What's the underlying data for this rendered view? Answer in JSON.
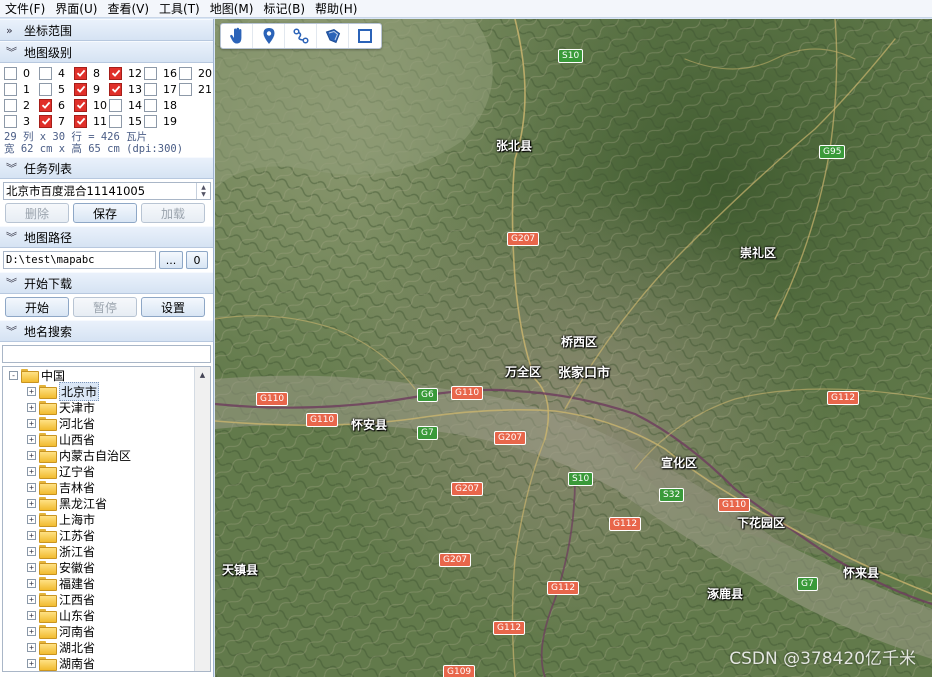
{
  "menubar": {
    "items": [
      "文件(F)",
      "界面(U)",
      "查看(V)",
      "工具(T)",
      "地图(M)",
      "标记(B)",
      "帮助(H)"
    ]
  },
  "sections": {
    "coord_range": "坐标范围",
    "map_level": "地图级别",
    "task_list": "任务列表",
    "map_path": "地图路径",
    "start_download": "开始下载",
    "place_search": "地名搜索"
  },
  "levels": [
    {
      "label": "0",
      "checked": false
    },
    {
      "label": "4",
      "checked": false
    },
    {
      "label": "8",
      "checked": true
    },
    {
      "label": "12",
      "checked": true
    },
    {
      "label": "16",
      "checked": false
    },
    {
      "label": "20",
      "checked": false
    },
    {
      "label": "1",
      "checked": false
    },
    {
      "label": "5",
      "checked": false
    },
    {
      "label": "9",
      "checked": true
    },
    {
      "label": "13",
      "checked": true
    },
    {
      "label": "17",
      "checked": false
    },
    {
      "label": "21",
      "checked": false
    },
    {
      "label": "2",
      "checked": false
    },
    {
      "label": "6",
      "checked": true
    },
    {
      "label": "10",
      "checked": true
    },
    {
      "label": "14",
      "checked": false
    },
    {
      "label": "18",
      "checked": false
    },
    {
      "label": "",
      "checked": null
    },
    {
      "label": "3",
      "checked": false
    },
    {
      "label": "7",
      "checked": true
    },
    {
      "label": "11",
      "checked": true
    },
    {
      "label": "15",
      "checked": false
    },
    {
      "label": "19",
      "checked": false
    },
    {
      "label": "",
      "checked": null
    }
  ],
  "tile_info": {
    "line1": "29 列 x 30 行 = 426 瓦片",
    "line2": "宽 62 cm x 高 65 cm (dpi:300)"
  },
  "task": {
    "selected": "北京市百度混合11141005",
    "buttons": {
      "delete": "删除",
      "save": "保存",
      "load": "加载"
    }
  },
  "path": {
    "value": "D:\\test\\mapabc",
    "browse_label": "...",
    "open_label": "0"
  },
  "download": {
    "buttons": {
      "start": "开始",
      "pause": "暂停",
      "settings": "设置"
    }
  },
  "search": {
    "value": ""
  },
  "tree": {
    "root": "中国",
    "children": [
      "北京市",
      "天津市",
      "河北省",
      "山西省",
      "内蒙古自治区",
      "辽宁省",
      "吉林省",
      "黑龙江省",
      "上海市",
      "江苏省",
      "浙江省",
      "安徽省",
      "福建省",
      "江西省",
      "山东省",
      "河南省",
      "湖北省",
      "湖南省"
    ]
  },
  "map": {
    "tools": [
      "pan-hand-icon",
      "place-marker-icon",
      "route-icon",
      "polygon-icon",
      "rectangle-select-icon"
    ],
    "places": [
      "张北县",
      "崇礼区",
      "桥西区",
      "万全区",
      "张家口市",
      "怀安县",
      "宣化区",
      "下花园区",
      "天镇县",
      "涿鹿县",
      "怀来县"
    ],
    "shields": [
      "S10",
      "G95",
      "G207",
      "G110",
      "G110",
      "G6",
      "G110",
      "G7",
      "G207",
      "G112",
      "S10",
      "S32",
      "G207",
      "G110",
      "G112",
      "G207",
      "G112",
      "G7",
      "G112",
      "G109"
    ],
    "watermark": "CSDN @378420亿千米"
  }
}
